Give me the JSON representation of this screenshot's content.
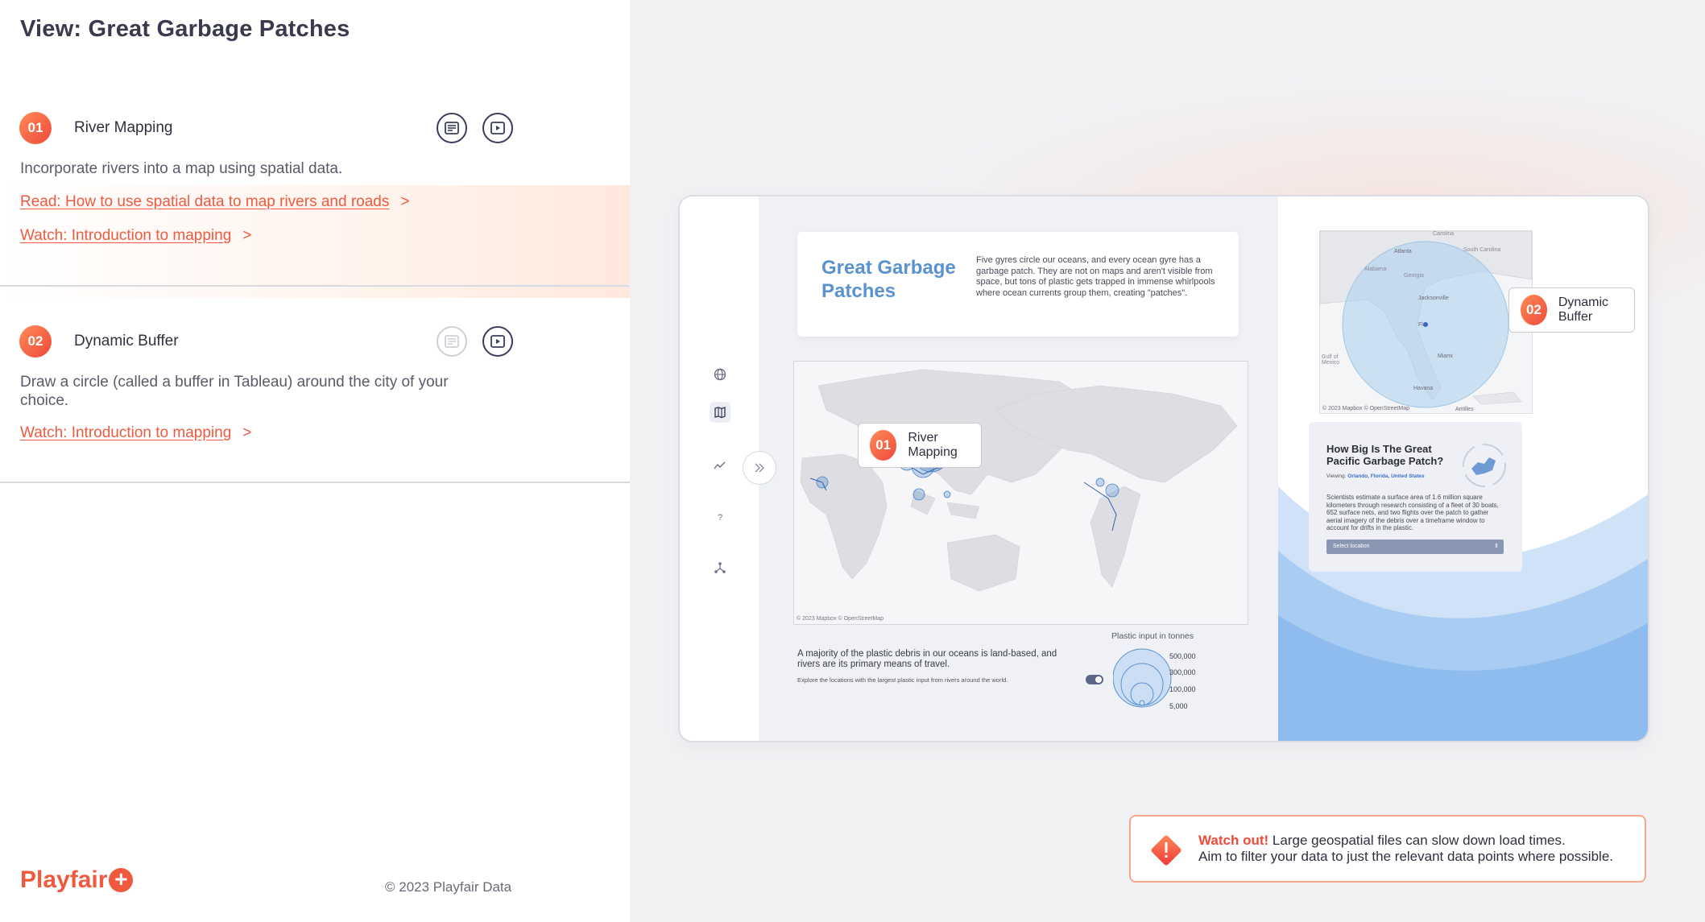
{
  "page": {
    "title": "View: Great Garbage Patches"
  },
  "steps": [
    {
      "num": "01",
      "name": "River Mapping",
      "desc": "Incorporate rivers into a map using spatial data.",
      "links": [
        "Read: How to use spatial data to map rivers and roads",
        "Watch: Introduction to mapping"
      ]
    },
    {
      "num": "02",
      "name": "Dynamic Buffer",
      "desc": "Draw a circle (called a buffer in Tableau) around the city of your choice.",
      "links": [
        "Watch: Introduction to mapping"
      ]
    }
  ],
  "footer": {
    "logo": "Playfair",
    "copyright": "© 2023 Playfair Data"
  },
  "dashboard": {
    "hero_title": "Great Garbage Patches",
    "hero_text": "Five gyres circle our oceans, and every ocean gyre has a garbage patch. They are not on maps and aren't visible from space, but tons of plastic gets trapped in immense whirlpools where ocean currents group them, creating \"patches\".",
    "map_credit": "© 2023 Mapbox © OpenStreetMap",
    "footnote": "A majority of the plastic debris in our oceans is land-based, and rivers are its primary means of travel.",
    "footnote_sub": "Explore the locations with the largest plastic input from rivers around the world.",
    "legend_title": "Plastic input in tonnes",
    "legend_values": [
      "500,000",
      "300,000",
      "100,000",
      "5,000"
    ],
    "fl_credit": "© 2023 Mapbox © OpenStreetMap",
    "fl_labels": [
      "Carolina",
      "Atlanta",
      "South Carolina",
      "Alabama",
      "Georgia",
      "Jacksonville",
      "Fla",
      "Miami",
      "Gulf of Mexico",
      "Havana",
      "Antilles"
    ],
    "info_title": "How Big Is The Great Pacific Garbage Patch?",
    "info_viewing_label": "Viewing:",
    "info_viewing_value": "Orlando, Florida, United States",
    "info_body": "Scientists estimate a surface area of 1.6 million square kilometers through research consisting of a fleet of 30 boats, 652 surface nets, and two flights over the patch to gather aerial imagery of the debris over a timeframe window to account for drifts in the plastic.",
    "info_select": "Select location",
    "callout1": "River Mapping",
    "callout2": "Dynamic Buffer"
  },
  "warning": {
    "strong": "Watch out!",
    "line1": "Large geospatial files can slow down load times.",
    "line2": "Aim to filter your data to just the relevant data points where possible."
  },
  "colors": {
    "accent": "#ef5a3e",
    "map_blue": "#5a92cf"
  }
}
